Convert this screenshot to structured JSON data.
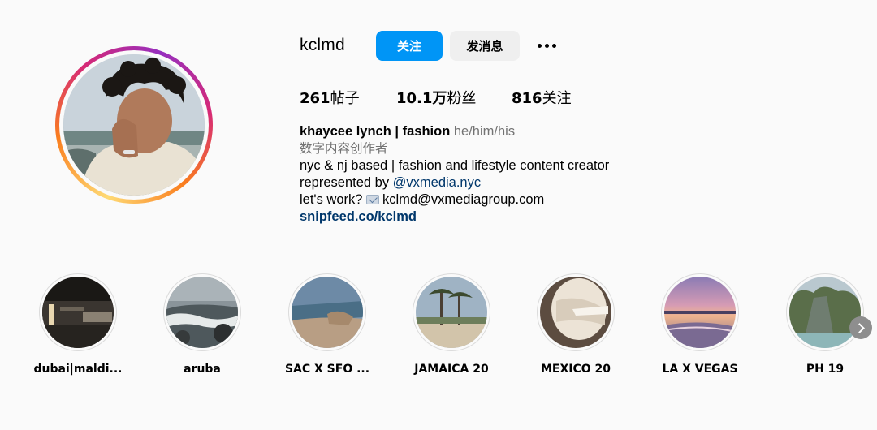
{
  "profile": {
    "username": "kclmd",
    "follow_label": "关注",
    "message_label": "发消息",
    "stats": {
      "posts": "261",
      "posts_label": "帖子",
      "followers": "10.1万",
      "followers_label": "粉丝",
      "following": "816",
      "following_label": "关注"
    },
    "bio": {
      "name": "khaycee lynch | fashion",
      "pronouns": "he/him/his",
      "category": "数字内容创作者",
      "line1": "nyc & nj based | fashion and lifestyle content creator",
      "line2_prefix": "represented by ",
      "line2_mention": "@vxmedia.nyc",
      "line3_prefix": "let's work? ",
      "line3_email": "kclmd@vxmediagroup.com",
      "link": "snipfeed.co/kclmd"
    }
  },
  "highlights": [
    {
      "label": "dubai|maldi...",
      "theme": "dark-interior"
    },
    {
      "label": "aruba",
      "theme": "rocky-sea"
    },
    {
      "label": "SAC X SFO ...",
      "theme": "coast-cliff"
    },
    {
      "label": "JAMAICA 20",
      "theme": "palm-beach"
    },
    {
      "label": "MEXICO 20",
      "theme": "plane-window"
    },
    {
      "label": "LA X VEGAS",
      "theme": "sunset-beach"
    },
    {
      "label": "PH 19",
      "theme": "tropical-cliff"
    }
  ],
  "icons": {
    "more": "more-horizontal-icon",
    "next": "chevron-right-icon",
    "mail": "envelope-icon"
  },
  "colors": {
    "accent": "#0095f6",
    "link": "#00376b",
    "muted": "#737373"
  }
}
